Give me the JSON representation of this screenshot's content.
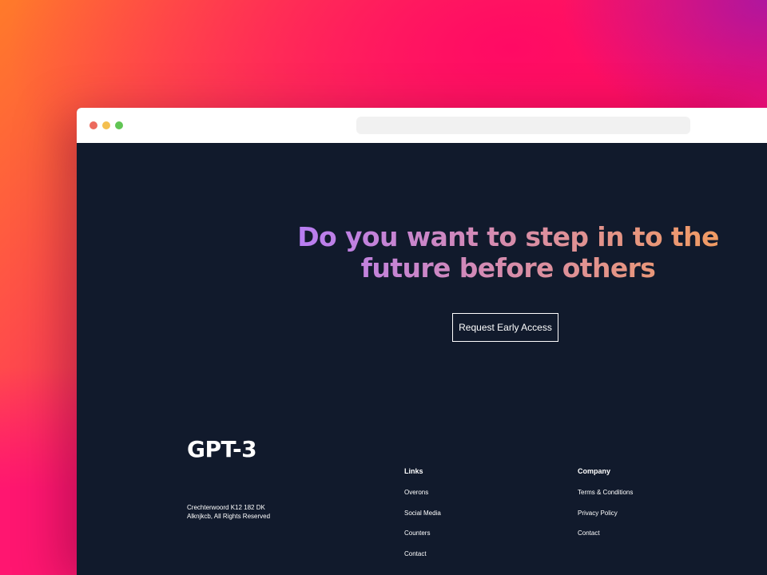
{
  "hero": {
    "heading": "Do you want to step in to the future before others",
    "cta_label": "Request Early Access"
  },
  "footer": {
    "logo": "GPT-3",
    "address_line1": "Crechterwoord K12 182 DK",
    "address_line2": "Alknjkcb, All Rights Reserved",
    "links": {
      "title": "Links",
      "items": [
        "Overons",
        "Social Media",
        "Counters",
        "Contact"
      ]
    },
    "company": {
      "title": "Company",
      "items": [
        "Terms & Conditions",
        "Privacy Policy",
        "Contact"
      ]
    }
  },
  "colors": {
    "page_bg": "#111a2c",
    "gradient_start": "#b67cf7",
    "gradient_end": "#f29c5f",
    "backdrop_orange": "#ff7a2a",
    "backdrop_pink": "#ff0a64",
    "backdrop_purple": "#c2189a"
  }
}
